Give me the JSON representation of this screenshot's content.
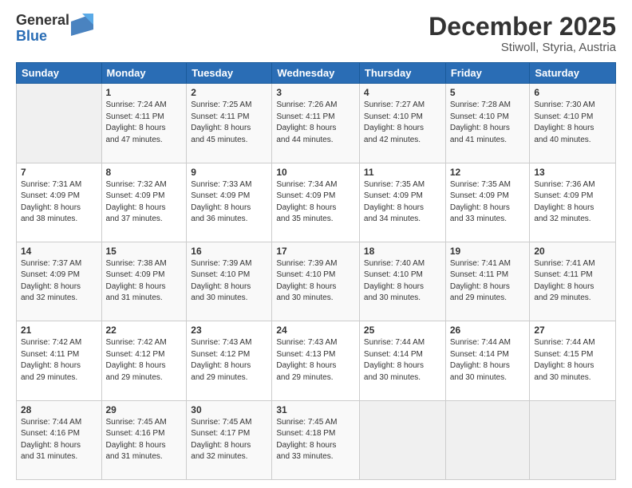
{
  "header": {
    "logo_general": "General",
    "logo_blue": "Blue",
    "title": "December 2025",
    "location": "Stiwoll, Styria, Austria"
  },
  "calendar": {
    "days_of_week": [
      "Sunday",
      "Monday",
      "Tuesday",
      "Wednesday",
      "Thursday",
      "Friday",
      "Saturday"
    ],
    "weeks": [
      [
        {
          "day": "",
          "info": ""
        },
        {
          "day": "1",
          "info": "Sunrise: 7:24 AM\nSunset: 4:11 PM\nDaylight: 8 hours\nand 47 minutes."
        },
        {
          "day": "2",
          "info": "Sunrise: 7:25 AM\nSunset: 4:11 PM\nDaylight: 8 hours\nand 45 minutes."
        },
        {
          "day": "3",
          "info": "Sunrise: 7:26 AM\nSunset: 4:11 PM\nDaylight: 8 hours\nand 44 minutes."
        },
        {
          "day": "4",
          "info": "Sunrise: 7:27 AM\nSunset: 4:10 PM\nDaylight: 8 hours\nand 42 minutes."
        },
        {
          "day": "5",
          "info": "Sunrise: 7:28 AM\nSunset: 4:10 PM\nDaylight: 8 hours\nand 41 minutes."
        },
        {
          "day": "6",
          "info": "Sunrise: 7:30 AM\nSunset: 4:10 PM\nDaylight: 8 hours\nand 40 minutes."
        }
      ],
      [
        {
          "day": "7",
          "info": "Sunrise: 7:31 AM\nSunset: 4:09 PM\nDaylight: 8 hours\nand 38 minutes."
        },
        {
          "day": "8",
          "info": "Sunrise: 7:32 AM\nSunset: 4:09 PM\nDaylight: 8 hours\nand 37 minutes."
        },
        {
          "day": "9",
          "info": "Sunrise: 7:33 AM\nSunset: 4:09 PM\nDaylight: 8 hours\nand 36 minutes."
        },
        {
          "day": "10",
          "info": "Sunrise: 7:34 AM\nSunset: 4:09 PM\nDaylight: 8 hours\nand 35 minutes."
        },
        {
          "day": "11",
          "info": "Sunrise: 7:35 AM\nSunset: 4:09 PM\nDaylight: 8 hours\nand 34 minutes."
        },
        {
          "day": "12",
          "info": "Sunrise: 7:35 AM\nSunset: 4:09 PM\nDaylight: 8 hours\nand 33 minutes."
        },
        {
          "day": "13",
          "info": "Sunrise: 7:36 AM\nSunset: 4:09 PM\nDaylight: 8 hours\nand 32 minutes."
        }
      ],
      [
        {
          "day": "14",
          "info": "Sunrise: 7:37 AM\nSunset: 4:09 PM\nDaylight: 8 hours\nand 32 minutes."
        },
        {
          "day": "15",
          "info": "Sunrise: 7:38 AM\nSunset: 4:09 PM\nDaylight: 8 hours\nand 31 minutes."
        },
        {
          "day": "16",
          "info": "Sunrise: 7:39 AM\nSunset: 4:10 PM\nDaylight: 8 hours\nand 30 minutes."
        },
        {
          "day": "17",
          "info": "Sunrise: 7:39 AM\nSunset: 4:10 PM\nDaylight: 8 hours\nand 30 minutes."
        },
        {
          "day": "18",
          "info": "Sunrise: 7:40 AM\nSunset: 4:10 PM\nDaylight: 8 hours\nand 30 minutes."
        },
        {
          "day": "19",
          "info": "Sunrise: 7:41 AM\nSunset: 4:11 PM\nDaylight: 8 hours\nand 29 minutes."
        },
        {
          "day": "20",
          "info": "Sunrise: 7:41 AM\nSunset: 4:11 PM\nDaylight: 8 hours\nand 29 minutes."
        }
      ],
      [
        {
          "day": "21",
          "info": "Sunrise: 7:42 AM\nSunset: 4:11 PM\nDaylight: 8 hours\nand 29 minutes."
        },
        {
          "day": "22",
          "info": "Sunrise: 7:42 AM\nSunset: 4:12 PM\nDaylight: 8 hours\nand 29 minutes."
        },
        {
          "day": "23",
          "info": "Sunrise: 7:43 AM\nSunset: 4:12 PM\nDaylight: 8 hours\nand 29 minutes."
        },
        {
          "day": "24",
          "info": "Sunrise: 7:43 AM\nSunset: 4:13 PM\nDaylight: 8 hours\nand 29 minutes."
        },
        {
          "day": "25",
          "info": "Sunrise: 7:44 AM\nSunset: 4:14 PM\nDaylight: 8 hours\nand 30 minutes."
        },
        {
          "day": "26",
          "info": "Sunrise: 7:44 AM\nSunset: 4:14 PM\nDaylight: 8 hours\nand 30 minutes."
        },
        {
          "day": "27",
          "info": "Sunrise: 7:44 AM\nSunset: 4:15 PM\nDaylight: 8 hours\nand 30 minutes."
        }
      ],
      [
        {
          "day": "28",
          "info": "Sunrise: 7:44 AM\nSunset: 4:16 PM\nDaylight: 8 hours\nand 31 minutes."
        },
        {
          "day": "29",
          "info": "Sunrise: 7:45 AM\nSunset: 4:16 PM\nDaylight: 8 hours\nand 31 minutes."
        },
        {
          "day": "30",
          "info": "Sunrise: 7:45 AM\nSunset: 4:17 PM\nDaylight: 8 hours\nand 32 minutes."
        },
        {
          "day": "31",
          "info": "Sunrise: 7:45 AM\nSunset: 4:18 PM\nDaylight: 8 hours\nand 33 minutes."
        },
        {
          "day": "",
          "info": ""
        },
        {
          "day": "",
          "info": ""
        },
        {
          "day": "",
          "info": ""
        }
      ]
    ]
  }
}
